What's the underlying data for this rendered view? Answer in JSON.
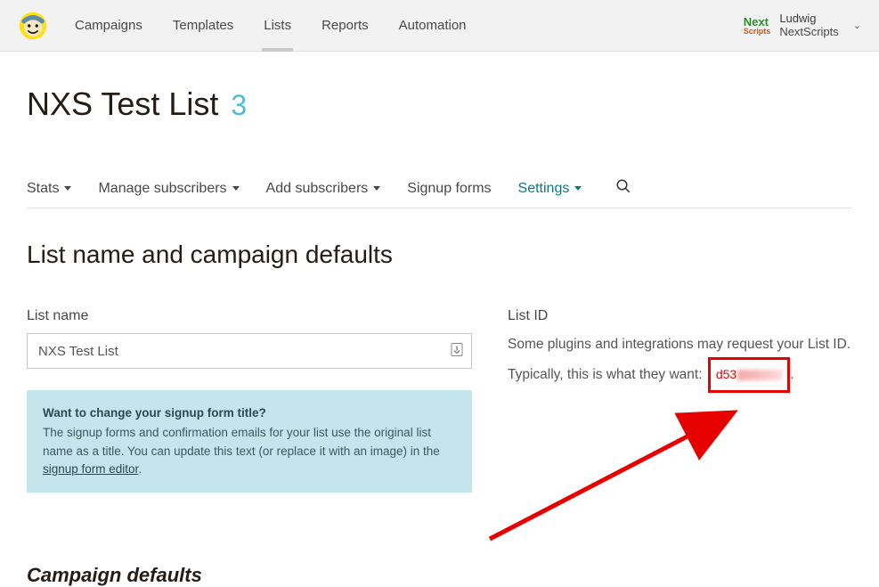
{
  "nav": {
    "items": [
      "Campaigns",
      "Templates",
      "Lists",
      "Reports",
      "Automation"
    ],
    "active_index": 2
  },
  "account": {
    "brand_top": "Next",
    "brand_bottom": "Scripts",
    "user": "Ludwig",
    "org": "NextScripts"
  },
  "page": {
    "title": "NXS Test List",
    "count": "3"
  },
  "subnav": {
    "items": [
      {
        "label": "Stats",
        "caret": true
      },
      {
        "label": "Manage subscribers",
        "caret": true
      },
      {
        "label": "Add subscribers",
        "caret": true
      },
      {
        "label": "Signup forms",
        "caret": false
      },
      {
        "label": "Settings",
        "caret": true,
        "teal": true
      }
    ]
  },
  "section_heading": "List name and campaign defaults",
  "left": {
    "label": "List name",
    "value": "NXS Test List",
    "info_q": "Want to change your signup form title?",
    "info_body_a": "The signup forms and confirmation emails for your list use the original list name as a title. You can update this text (or replace it with an image) in the ",
    "info_link": "signup form editor",
    "info_body_b": "."
  },
  "right": {
    "label": "List ID",
    "line1": "Some plugins and integrations may request your List ID.",
    "line2a": "Typically, this is what they want: ",
    "listid_visible": "d53",
    "line2b": "."
  },
  "bottom_heading": "Campaign defaults"
}
